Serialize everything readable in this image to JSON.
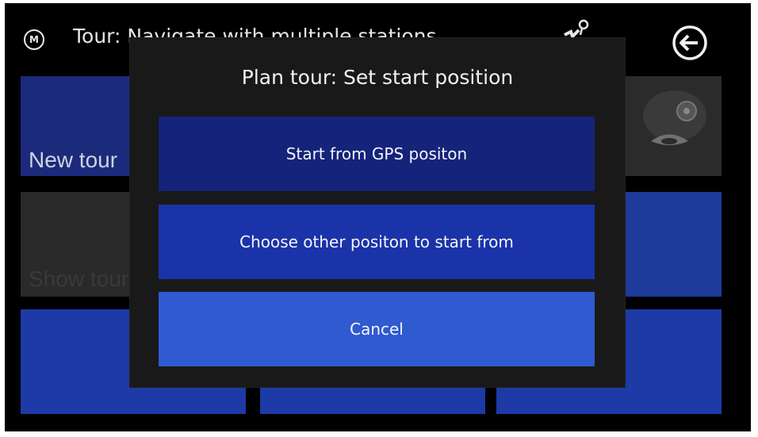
{
  "header": {
    "menu_badge": "M",
    "title": "Tour: Navigate with multiple stations",
    "icons": [
      "signal-icon",
      "back-arrow-icon"
    ]
  },
  "tiles": {
    "new_tour_label": "New tour",
    "show_tours_label": "Show tours",
    "car_icon": "car-icon"
  },
  "dialog": {
    "title": "Plan tour: Set start position",
    "buttons": [
      {
        "label": "Start from GPS positon"
      },
      {
        "label": "Choose other positon to start from"
      },
      {
        "label": "Cancel"
      }
    ]
  },
  "colors": {
    "background": "#000000",
    "dialog": "#191919",
    "button_dark": "#15237a",
    "button_mid": "#1b33a8",
    "button_light": "#2f5ad0"
  }
}
